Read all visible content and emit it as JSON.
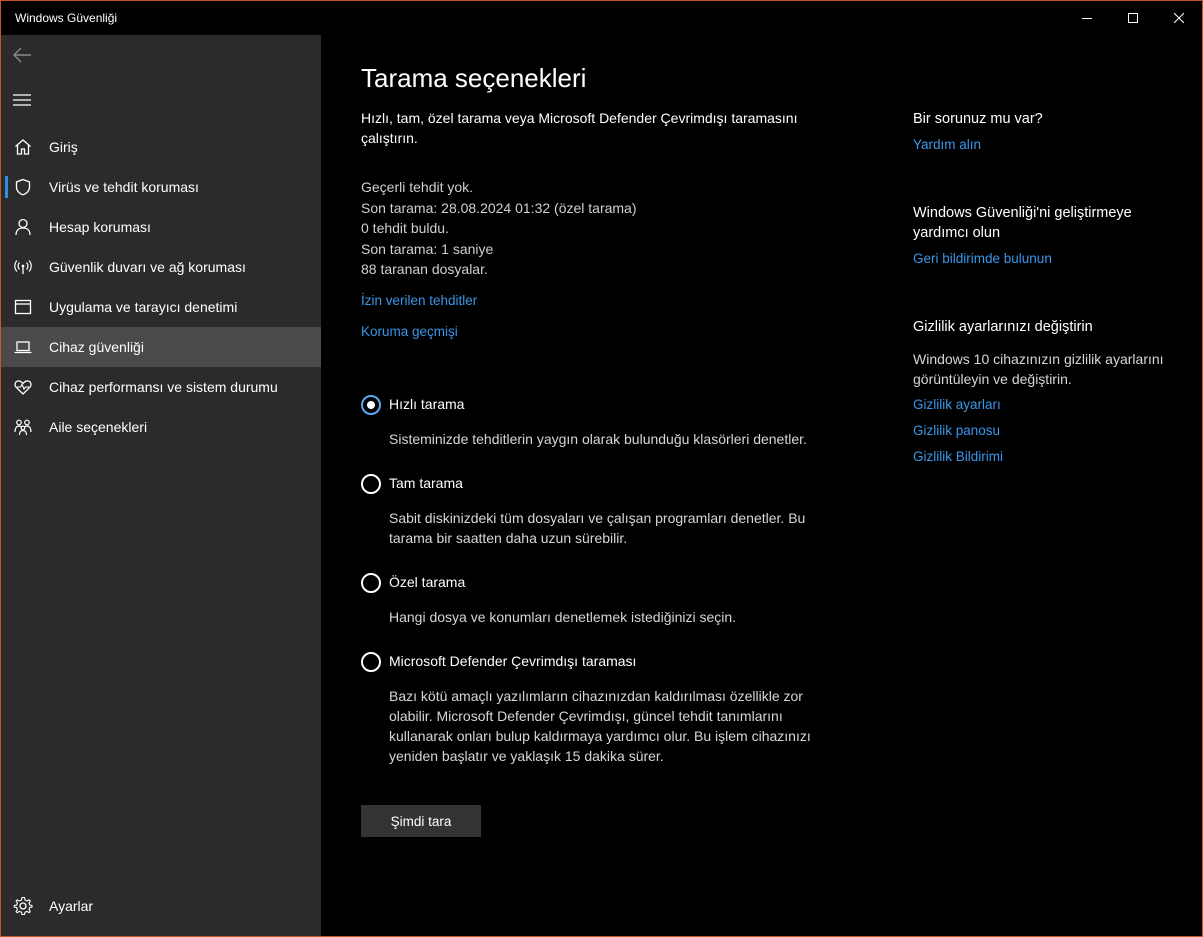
{
  "window": {
    "title": "Windows Güvenliği"
  },
  "sidebar": {
    "items": [
      {
        "label": "Giriş",
        "icon": "home-icon"
      },
      {
        "label": "Virüs ve tehdit koruması",
        "icon": "shield-icon"
      },
      {
        "label": "Hesap koruması",
        "icon": "person-icon"
      },
      {
        "label": "Güvenlik duvarı ve ağ koruması",
        "icon": "wifi-antenna-icon"
      },
      {
        "label": "Uygulama ve tarayıcı denetimi",
        "icon": "browser-window-icon"
      },
      {
        "label": "Cihaz güvenliği",
        "icon": "laptop-icon"
      },
      {
        "label": "Cihaz performansı ve sistem durumu",
        "icon": "heart-pulse-icon"
      },
      {
        "label": "Aile seçenekleri",
        "icon": "family-icon"
      }
    ],
    "selected_index": 5,
    "indicator_index": 1,
    "settings_label": "Ayarlar"
  },
  "main": {
    "title": "Tarama seçenekleri",
    "subtitle": "Hızlı, tam, özel tarama veya Microsoft Defender Çevrimdışı taramasını çalıştırın.",
    "status_lines": [
      "Geçerli tehdit yok.",
      "Son tarama: 28.08.2024 01:32 (özel tarama)",
      "0 tehdit buldu.",
      "Son tarama: 1 saniye",
      "88 taranan dosyalar."
    ],
    "allowed_threats_link": "İzin verilen tehditler",
    "protection_history_link": "Koruma geçmişi",
    "options": [
      {
        "label": "Hızlı tarama",
        "description": "Sisteminizde tehditlerin yaygın olarak bulunduğu klasörleri denetler.",
        "checked": true
      },
      {
        "label": "Tam tarama",
        "description": "Sabit diskinizdeki tüm dosyaları ve çalışan programları denetler. Bu tarama bir saatten daha uzun sürebilir.",
        "checked": false
      },
      {
        "label": "Özel tarama",
        "description": "Hangi dosya ve konumları denetlemek istediğinizi seçin.",
        "checked": false
      },
      {
        "label": "Microsoft Defender Çevrimdışı taraması",
        "description": "Bazı kötü amaçlı yazılımların cihazınızdan kaldırılması özellikle zor olabilir. Microsoft Defender Çevrimdışı, güncel tehdit tanımlarını kullanarak onları bulup kaldırmaya yardımcı olur. Bu işlem cihazınızı yeniden başlatır ve yaklaşık 15 dakika sürer.",
        "checked": false
      }
    ],
    "scan_button": "Şimdi tara"
  },
  "right": {
    "question_heading": "Bir sorunuz mu var?",
    "help_link": "Yardım alın",
    "improve_heading": "Windows Güvenliği'ni geliştirmeye yardımcı olun",
    "feedback_link": "Geri bildirimde bulunun",
    "privacy_heading": "Gizlilik ayarlarınızı değiştirin",
    "privacy_text": "Windows 10 cihazınızın gizlilik ayarlarını görüntüleyin ve değiştirin.",
    "privacy_settings_link": "Gizlilik ayarları",
    "privacy_dashboard_link": "Gizlilik panosu",
    "privacy_statement_link": "Gizlilik Bildirimi"
  },
  "colors": {
    "accent": "#3b96e8",
    "sidebar_bg": "#2b2b2b",
    "selected_bg": "#4a4a4a"
  }
}
